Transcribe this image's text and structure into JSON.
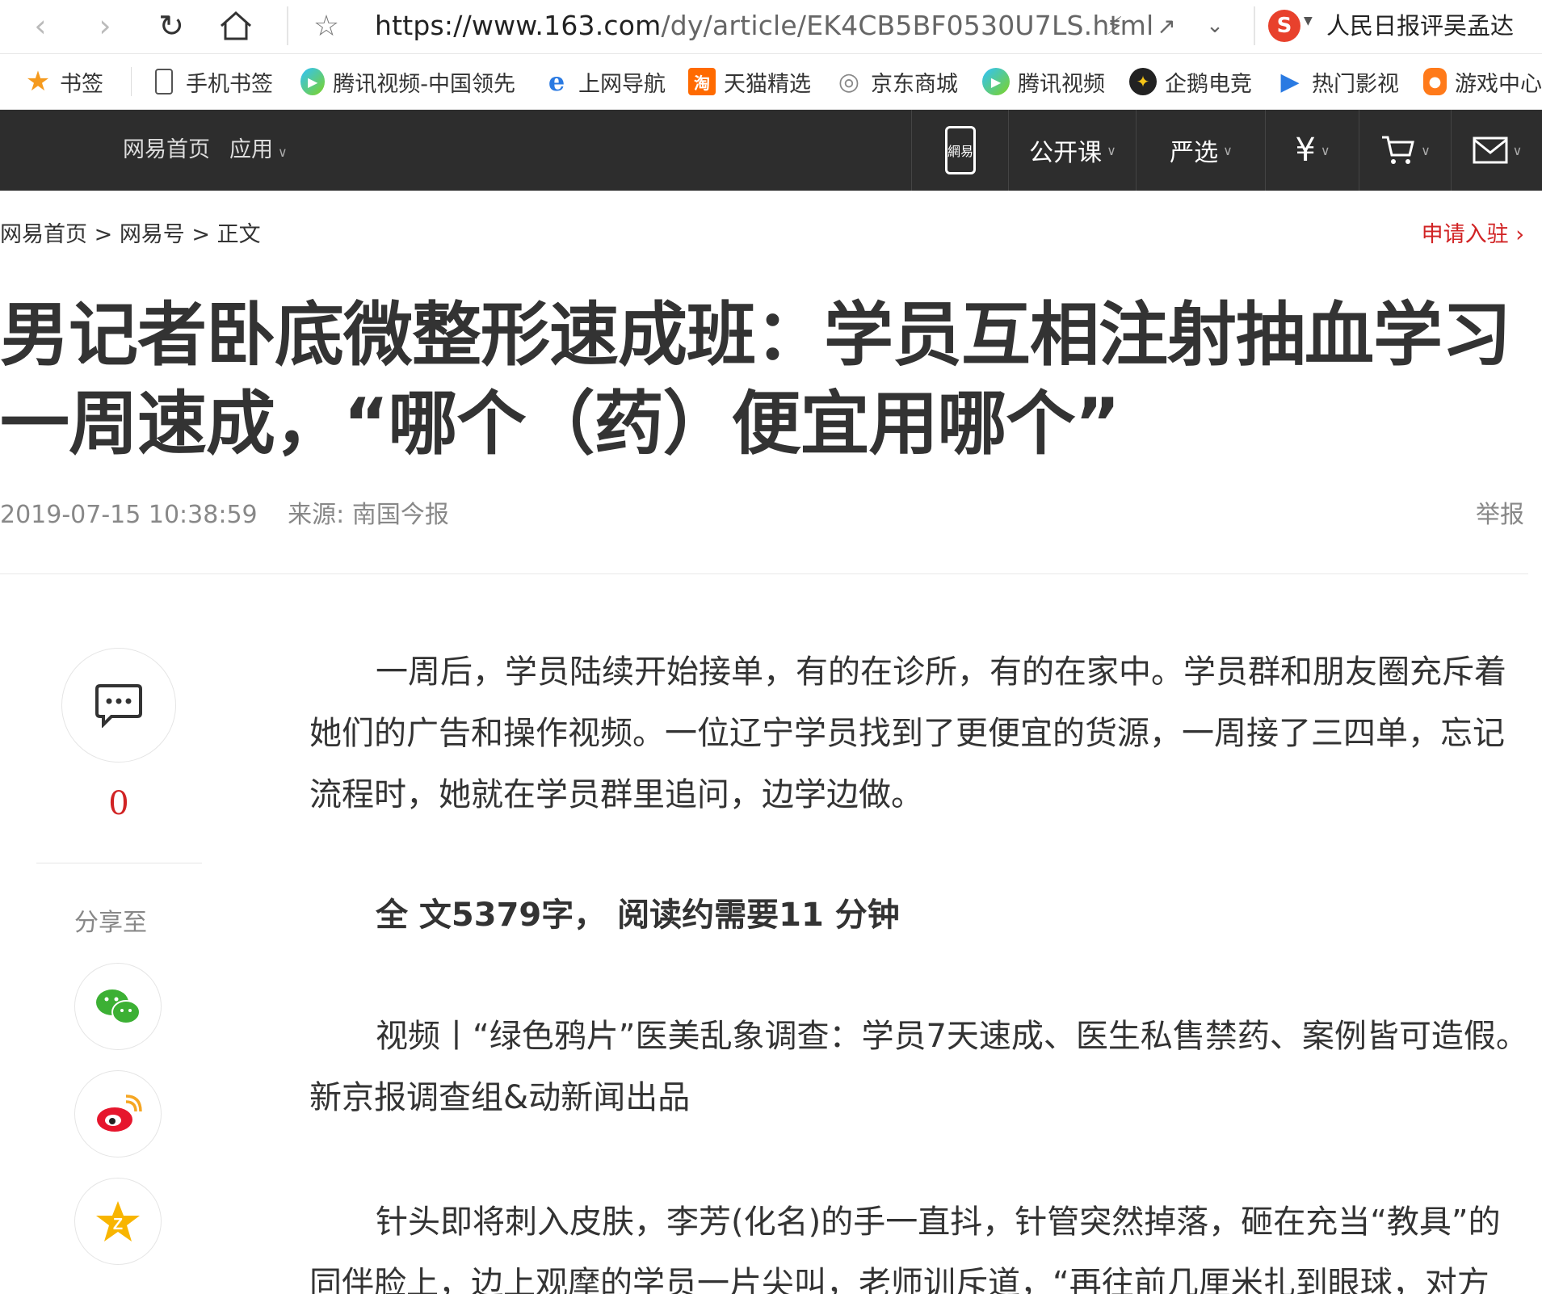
{
  "browser": {
    "url_host": "https://www.163.com",
    "url_path": "/dy/article/EK4CB5BF0530U7LS.html",
    "search_text": "人民日报评吴孟达"
  },
  "bookmarks": [
    {
      "label": "书签",
      "icon": "star-icon",
      "color": "#f59a1e"
    },
    {
      "label": "手机书签",
      "icon": "phone-icon",
      "color": "#555555"
    },
    {
      "label": "腾讯视频-中国领先",
      "icon": "tencent-video-icon",
      "color": "#3aa0f0"
    },
    {
      "label": "上网导航",
      "icon": "ie-icon",
      "color": "#2a7ae2"
    },
    {
      "label": "天猫精选",
      "icon": "taobao-icon",
      "color": "#ff6a00"
    },
    {
      "label": "京东商城",
      "icon": "globe-icon",
      "color": "#888888"
    },
    {
      "label": "腾讯视频",
      "icon": "tencent-video-icon",
      "color": "#3aa0f0"
    },
    {
      "label": "企鹅电竞",
      "icon": "esports-icon",
      "color": "#222222"
    },
    {
      "label": "热门影视",
      "icon": "play-icon",
      "color": "#2a7ae2"
    },
    {
      "label": "游戏中心",
      "icon": "gamepad-icon",
      "color": "#ff7a1a"
    }
  ],
  "sitenav": {
    "home": "网易首页",
    "apps": "应用",
    "mobile_logo": "網易",
    "opencourse": "公开课",
    "yanxuan": "严选"
  },
  "breadcrumb": {
    "home": "网易首页",
    "sep": ">",
    "hao": "网易号",
    "current": "正文"
  },
  "apply": "申请入驻",
  "article": {
    "title": "男记者卧底微整形速成班：学员互相注射抽血学习一周速成，“哪个（药）便宜用哪个”",
    "time": "2019-07-15 10:38:59",
    "source": "来源: 南国今报",
    "report": "举报",
    "comment_count": "0",
    "share_label": "分享至",
    "para1": "一周后，学员陆续开始接单，有的在诊所，有的在家中。学员群和朋友圈充斥着她们的广告和操作视频。一位辽宁学员找到了更便宜的货源，一周接了三四单，忘记流程时，她就在学员群里追问，边学边做。",
    "summary": "全 文5379字， 阅读约需要11 分钟",
    "para2": "视频丨“绿色鸦片”医美乱象调查：学员7天速成、医生私售禁药、案例皆可造假。新京报调查组&动新闻出品",
    "para3": "针头即将刺入皮肤，李芳(化名)的手一直抖，针管突然掉落，砸在充当“教具”的同伴脸上，边上观摩的学员一片尖叫，老师训斥道，“再往前几厘米扎到眼球，对方"
  },
  "colors": {
    "accent_red": "#d12324",
    "nav_bg": "#2d2d2d",
    "wechat": "#3cb034",
    "weibo": "#e6162d",
    "qzone": "#f8b500"
  }
}
